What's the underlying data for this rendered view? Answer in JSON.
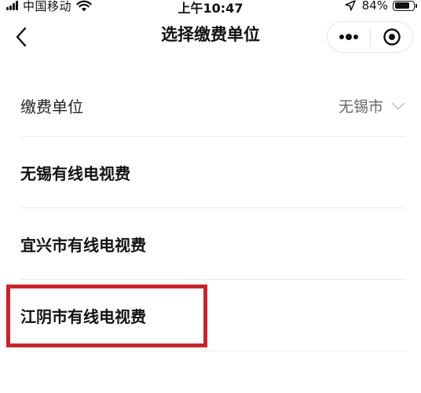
{
  "status_bar": {
    "carrier": "中国移动",
    "time": "上午10:47",
    "battery": "84%",
    "battery_level": 0.84,
    "icons": [
      "signal-icon",
      "wifi-icon",
      "location-arrow-icon",
      "battery-icon"
    ]
  },
  "nav": {
    "title": "选择缴费单位",
    "icons": [
      "chevron-left-icon",
      "more-dots-icon",
      "target-close-icon"
    ]
  },
  "unit_selector": {
    "label": "缴费单位",
    "value": "无锡市",
    "icon": "chevron-down-icon"
  },
  "options": [
    {
      "label": "无锡有线电视费"
    },
    {
      "label": "宜兴市有线电视费"
    },
    {
      "label": "江阴市有线电视费"
    }
  ],
  "annotation": {
    "highlighted_option": "江阴市有线电视费",
    "color": "#c8242b"
  },
  "colors": {
    "background": "#ffffff",
    "text": "#111111",
    "muted": "#666666",
    "divider": "#ececec"
  }
}
